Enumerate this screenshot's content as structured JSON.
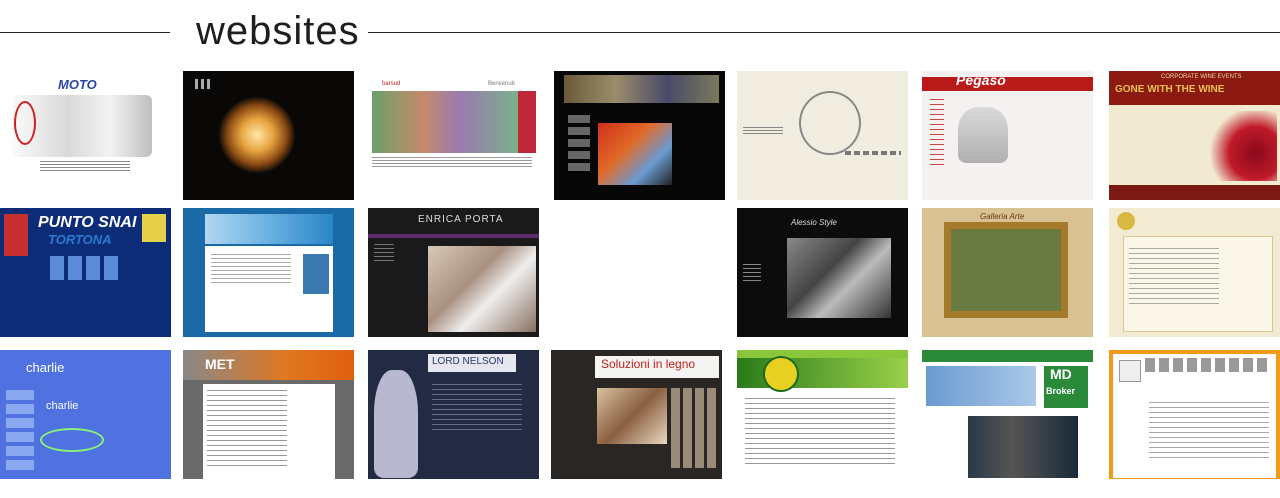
{
  "section": {
    "title": "websites"
  },
  "thumbnails": [
    {
      "id": "moto",
      "label": "MOTO"
    },
    {
      "id": "lamp"
    },
    {
      "id": "barsud",
      "label": "barsud",
      "label2": "Benvenuti"
    },
    {
      "id": "gallery"
    },
    {
      "id": "design-beige"
    },
    {
      "id": "pegaso",
      "label": "Pegaso"
    },
    {
      "id": "wine",
      "label": "GONE WITH THE WINE",
      "label2": "CORPORATE WINE EVENTS"
    },
    {
      "id": "snai",
      "label": "PUNTO SNAI",
      "label2": "TORTONA"
    },
    {
      "id": "blue-site"
    },
    {
      "id": "enrica",
      "label": "ENRICA PORTA"
    },
    {
      "id": "alessio",
      "label": "Alessio Style"
    },
    {
      "id": "galleria",
      "label": "Galleria Arte"
    },
    {
      "id": "cream"
    },
    {
      "id": "charlie",
      "label": "charlie",
      "label2": "charlie"
    },
    {
      "id": "met",
      "label": "MET"
    },
    {
      "id": "lord-nelson",
      "label": "LORD NELSON"
    },
    {
      "id": "legno",
      "label": "Soluzioni in legno"
    },
    {
      "id": "green"
    },
    {
      "id": "md-broker",
      "label": "MD",
      "label2": "Broker"
    },
    {
      "id": "orange"
    }
  ]
}
